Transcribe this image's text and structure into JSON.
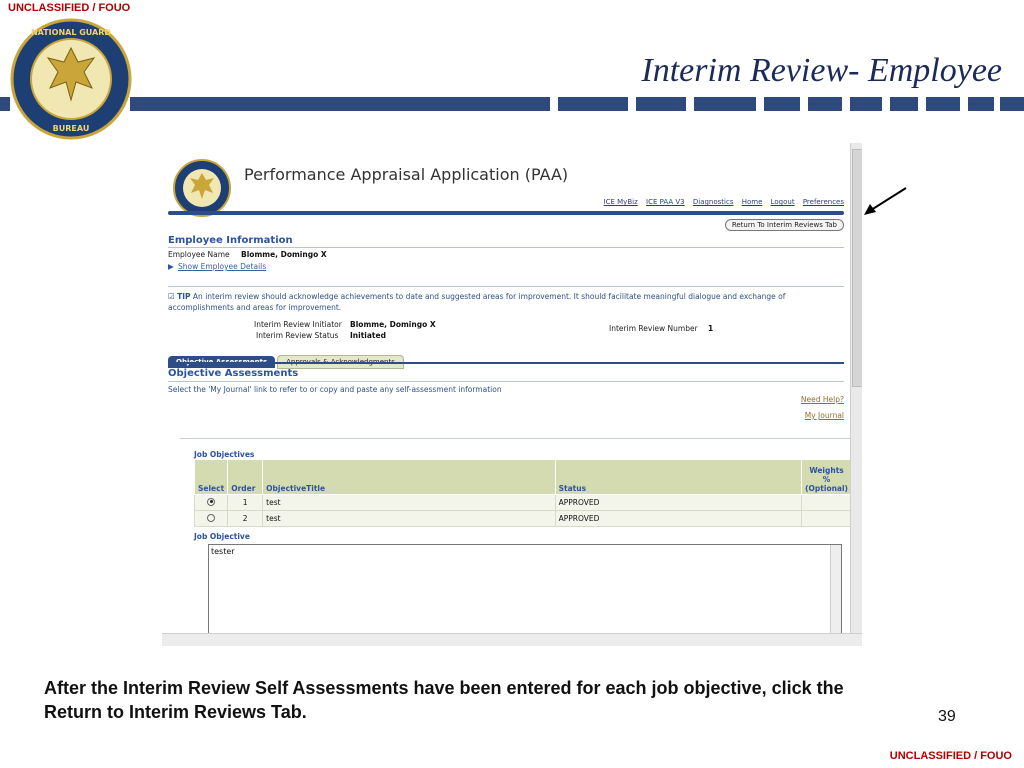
{
  "classification": "UNCLASSIFIED / FOUO",
  "slide": {
    "title": "Interim Review- Employee",
    "caption": "After the Interim Review Self Assessments have been entered for each job objective, click the Return to Interim Reviews Tab.",
    "page_number": "39",
    "seal_text": "NATIONAL GUARD BUREAU"
  },
  "app": {
    "title": "Performance Appraisal Application (PAA)",
    "links": [
      "ICE MyBiz",
      "ICE PAA V3",
      "Diagnostics",
      "Home",
      "Logout",
      "Preferences"
    ],
    "return_button": "Return To Interim Reviews Tab",
    "employee_info": {
      "heading": "Employee Information",
      "name_label": "Employee Name",
      "name_value": "Blomme, Domingo X",
      "show_details": "Show Employee Details"
    },
    "tip": {
      "label": "TIP",
      "text": "An interim review should acknowledge achievements to date and suggested areas for improvement. It should facilitate meaningful dialogue and exchange of accomplishments and areas for improvement."
    },
    "review": {
      "initiator_label": "Interim Review Initiator",
      "initiator_value": "Blomme, Domingo X",
      "status_label": "Interim Review Status",
      "status_value": "Initiated",
      "number_label": "Interim Review Number",
      "number_value": "1"
    },
    "tabs": [
      "Objective Assessments",
      "Approvals & Acknowledgments"
    ],
    "objective_assessments": {
      "heading": "Objective Assessments",
      "description": "Select the 'My Journal' link to refer to or copy and paste any self-assessment information",
      "need_help": "Need Help?",
      "my_journal": "My Journal"
    },
    "job_objectives": {
      "heading": "Job Objectives",
      "columns": [
        "Select",
        "Order",
        "ObjectiveTitle",
        "Status",
        "Weights % (Optional)"
      ],
      "rows": [
        {
          "selected": true,
          "order": "1",
          "title": "test",
          "status": "APPROVED",
          "weight": ""
        },
        {
          "selected": false,
          "order": "2",
          "title": "test",
          "status": "APPROVED",
          "weight": ""
        }
      ]
    },
    "job_objective": {
      "label": "Job Objective",
      "text": "tester"
    }
  }
}
